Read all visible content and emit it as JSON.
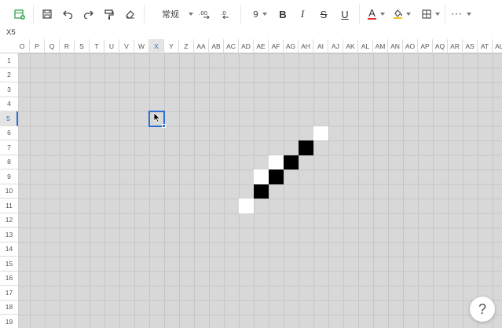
{
  "toolbar": {
    "format_label": "常规",
    "font_size": "9",
    "bold": "B",
    "italic": "I",
    "strike": "S",
    "underline": "U",
    "font_color_letter": "A",
    "more": "···",
    "colors": {
      "font_color": "#e0322a",
      "fill_color": "#f5c518",
      "accent": "#2a6fd6",
      "icon": "#3daa5c"
    }
  },
  "namebox": {
    "value": "X5"
  },
  "columns": [
    "O",
    "P",
    "Q",
    "R",
    "S",
    "T",
    "U",
    "V",
    "W",
    "X",
    "Y",
    "Z",
    "AA",
    "AB",
    "AC",
    "AD",
    "AE",
    "AF",
    "AG",
    "AH",
    "AI",
    "AJ",
    "AK",
    "AL",
    "AM",
    "AN",
    "AO",
    "AP",
    "AQ",
    "AR",
    "AS",
    "AT",
    "AU"
  ],
  "rows": [
    "1",
    "2",
    "3",
    "4",
    "5",
    "6",
    "7",
    "8",
    "9",
    "10",
    "11",
    "12",
    "13",
    "14",
    "15",
    "16",
    "17",
    "18",
    "19"
  ],
  "active_column": "X",
  "active_row": "5",
  "filled_cells": [
    {
      "col": "AI",
      "row": 6,
      "color": "white"
    },
    {
      "col": "AH",
      "row": 7,
      "color": "black"
    },
    {
      "col": "AF",
      "row": 8,
      "color": "white"
    },
    {
      "col": "AG",
      "row": 8,
      "color": "black"
    },
    {
      "col": "AE",
      "row": 9,
      "color": "white"
    },
    {
      "col": "AF",
      "row": 9,
      "color": "black"
    },
    {
      "col": "AE",
      "row": 10,
      "color": "black"
    },
    {
      "col": "AD",
      "row": 11,
      "color": "white"
    }
  ],
  "help": {
    "label": "?"
  }
}
